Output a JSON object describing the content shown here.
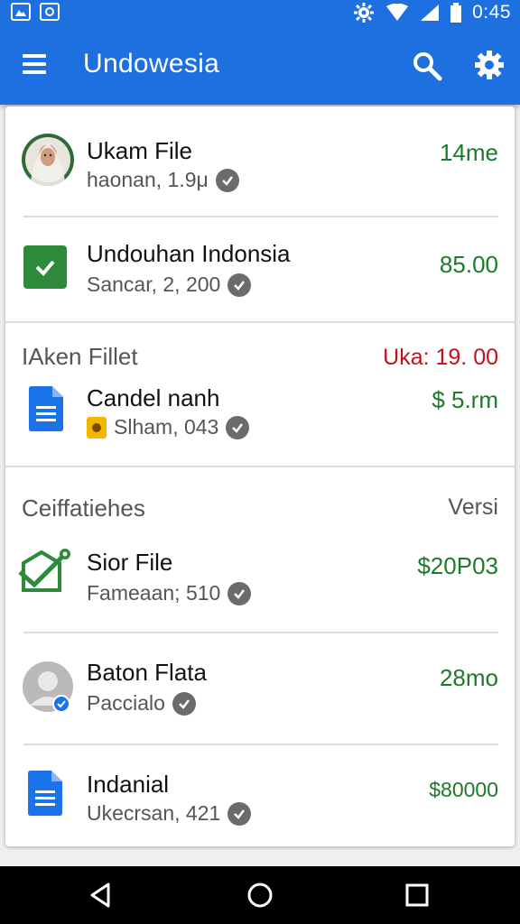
{
  "status_bar": {
    "time": "0:45",
    "icons": [
      "photo-icon",
      "phone-frame-icon",
      "settings-gear-icon",
      "wifi-icon",
      "signal-icon",
      "battery-icon"
    ]
  },
  "app_bar": {
    "title": "Undowesia",
    "icons": [
      "menu-icon",
      "search-icon",
      "settings-icon"
    ]
  },
  "items": [
    {
      "title": "Ukam File",
      "subtitle": "haonan, 1.9μ",
      "amount": "14me",
      "icon": "avatar-icon"
    },
    {
      "title": "Undouhan Indonsia",
      "subtitle": "Sancar, 2, 200",
      "amount": "85.00",
      "icon": "checkbox-icon"
    }
  ],
  "section1": {
    "header": "IAken Fillet",
    "right_text": "Uka: 19. 00",
    "right_color": "#c0121c",
    "items": [
      {
        "title": "Candel nanh",
        "subtitle": "Slham, 043",
        "amount": "$ 5.rm",
        "icon": "document-icon",
        "badge": "folder-badge-icon"
      }
    ]
  },
  "section2": {
    "header": "Ceiffatiehes",
    "right_text": "Versi",
    "items": [
      {
        "title": "Sior File",
        "subtitle": "Fameaan; 510",
        "amount": "$20P03",
        "icon": "verified-file-icon"
      },
      {
        "title": "Baton Flata",
        "subtitle": "Paccialo",
        "amount": "28mo",
        "icon": "user-avatar-icon"
      },
      {
        "title": "Indanial",
        "subtitle": "Ukecrsan, 421",
        "amount": "$80000",
        "icon": "document-icon"
      }
    ]
  },
  "nav_bar": {
    "icons": [
      "back-icon",
      "home-icon",
      "recents-icon"
    ]
  },
  "colors": {
    "primary": "#1e6fe0",
    "amount_green": "#1d7a2a",
    "alert_red": "#c0121c"
  }
}
